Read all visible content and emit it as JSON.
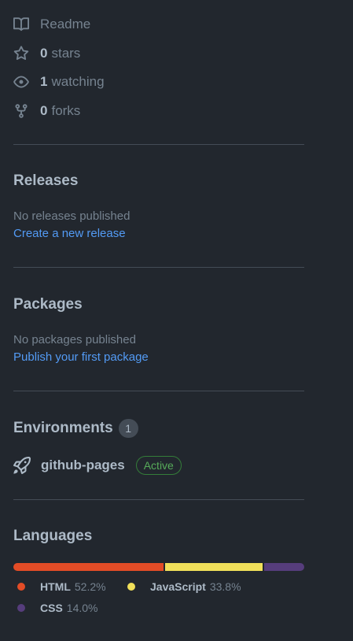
{
  "about": {
    "readme_label": "Readme",
    "stars_count": "0",
    "stars_label": "stars",
    "watching_count": "1",
    "watching_label": "watching",
    "forks_count": "0",
    "forks_label": "forks"
  },
  "releases": {
    "title": "Releases",
    "empty_text": "No releases published",
    "create_link": "Create a new release"
  },
  "packages": {
    "title": "Packages",
    "empty_text": "No packages published",
    "publish_link": "Publish your first package"
  },
  "environments": {
    "title": "Environments",
    "count": "1",
    "items": [
      {
        "name": "github-pages",
        "status": "Active"
      }
    ]
  },
  "languages": {
    "title": "Languages",
    "items": [
      {
        "name": "HTML",
        "percent": "52.2%",
        "value": 52.2,
        "color": "#e34c26"
      },
      {
        "name": "JavaScript",
        "percent": "33.8%",
        "value": 33.8,
        "color": "#f1e05a"
      },
      {
        "name": "CSS",
        "percent": "14.0%",
        "value": 14.0,
        "color": "#563d7c"
      }
    ]
  }
}
